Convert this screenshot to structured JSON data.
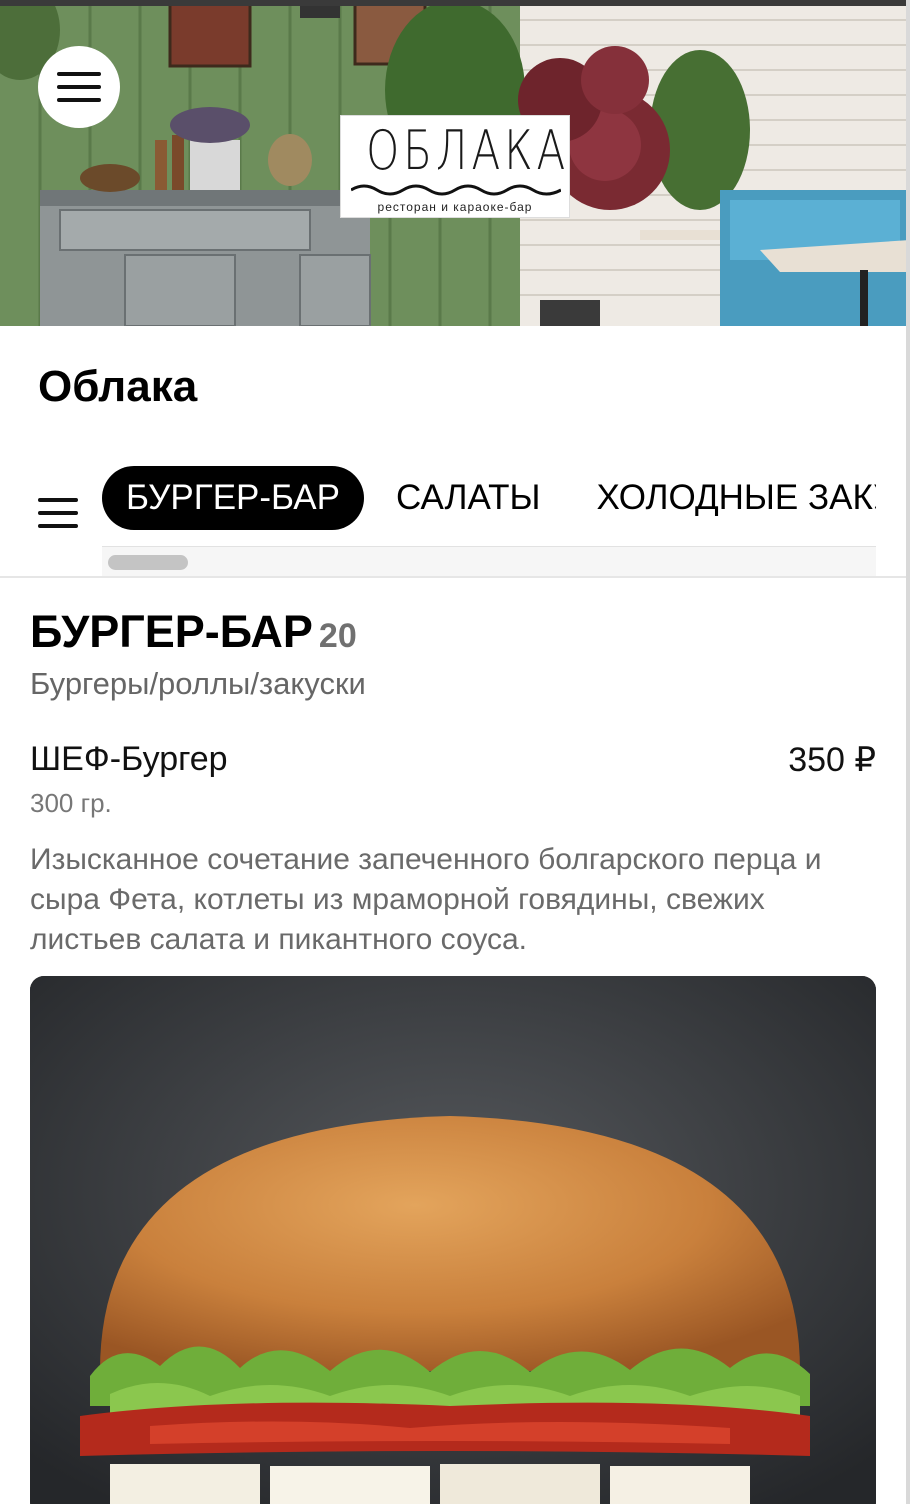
{
  "header": {
    "logo_text": "ОБЛАКА",
    "logo_tagline": "ресторан и караоке-бар",
    "restaurant_name": "Облака"
  },
  "categories": [
    {
      "label": "БУРГЕР-БАР",
      "active": true
    },
    {
      "label": "САЛАТЫ",
      "active": false
    },
    {
      "label": "ХОЛОДНЫЕ ЗАКУСКИ",
      "active": false
    }
  ],
  "section": {
    "title": "БУРГЕР-БАР",
    "count": "20",
    "subtitle": "Бургеры/роллы/закуски"
  },
  "items": [
    {
      "name": "ШЕФ-Бургер",
      "price": "350 ₽",
      "weight": "300 гр.",
      "description": "Изысканное сочетание запеченного болгарского перца и сыра Фета, котлеты из мраморной говядины, свежих листьев салата и пикантного соуса."
    }
  ],
  "colors": {
    "accent": "#000000",
    "muted_text": "#6a6a6a",
    "count_text": "#707070"
  },
  "icons": {
    "menu": "hamburger-menu-icon",
    "category_menu": "category-list-icon"
  }
}
